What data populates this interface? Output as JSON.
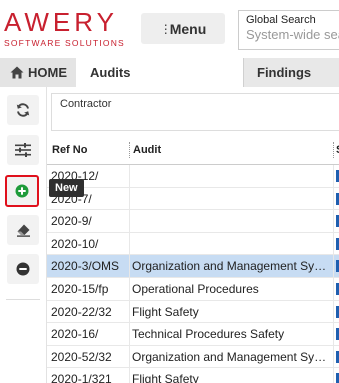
{
  "header": {
    "logo_main": "AWERY",
    "logo_sub": "SOFTWARE SOLUTIONS",
    "menu_label": "Menu",
    "search_label": "Global Search",
    "search_placeholder": "System-wide sea"
  },
  "tabs": [
    {
      "label": "HOME",
      "icon": "home-icon"
    },
    {
      "label": "Audits"
    },
    {
      "label": "Findings"
    }
  ],
  "sidebar": {
    "buttons": [
      {
        "icon": "refresh-icon"
      },
      {
        "icon": "sliders-icon"
      },
      {
        "icon": "plus-circle-icon",
        "tooltip": "New"
      },
      {
        "icon": "eraser-icon"
      },
      {
        "icon": "minus-circle-icon"
      }
    ],
    "tooltip": "New"
  },
  "filter": {
    "label": "Contractor"
  },
  "grid": {
    "columns": [
      "Ref No",
      "Audit",
      "S"
    ],
    "rows": [
      {
        "ref": "2020-12/",
        "audit": "",
        "selected": false
      },
      {
        "ref": "2020-7/",
        "audit": "",
        "selected": false
      },
      {
        "ref": "2020-9/",
        "audit": "",
        "selected": false
      },
      {
        "ref": "2020-10/",
        "audit": "",
        "selected": false
      },
      {
        "ref": "2020-3/OMS",
        "audit": "Organization and Management Syst...",
        "selected": true
      },
      {
        "ref": "2020-15/fp",
        "audit": "Operational Procedures",
        "selected": false
      },
      {
        "ref": "2020-22/32",
        "audit": "Flight Safety",
        "selected": false
      },
      {
        "ref": "2020-16/",
        "audit": "Technical Procedures Safety",
        "selected": false
      },
      {
        "ref": "2020-52/32",
        "audit": "Organization and Management Syst...",
        "selected": false
      },
      {
        "ref": "2020-1/321",
        "audit": "Flight Safety",
        "selected": false
      }
    ]
  },
  "colors": {
    "brand": "#c8202f",
    "selected_row": "#c7dcf3",
    "status_marker": "#1f5fb0",
    "new_icon": "#1e9b3a",
    "highlight_border": "#e0101c"
  }
}
